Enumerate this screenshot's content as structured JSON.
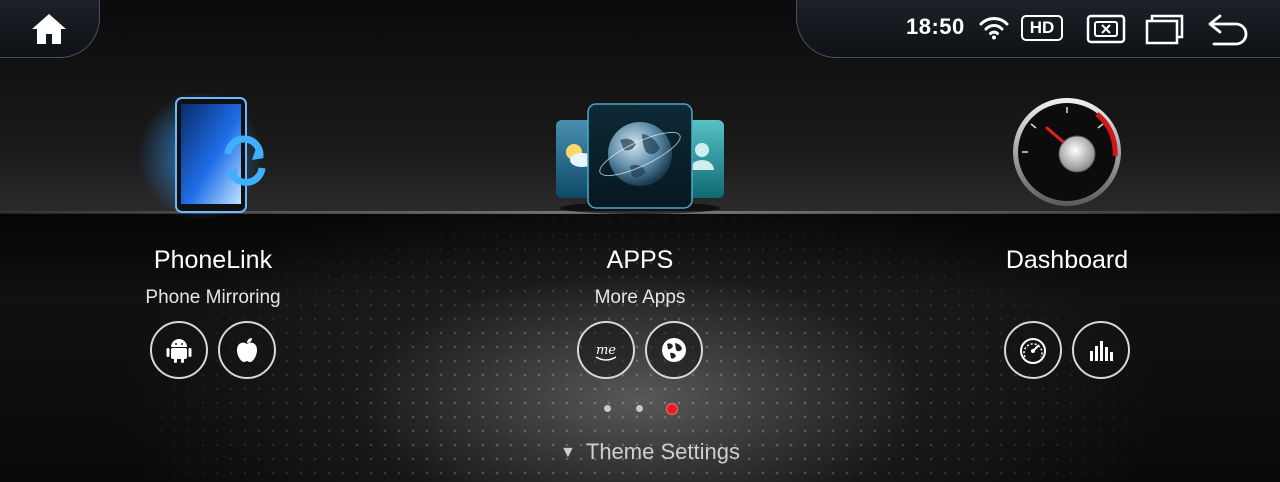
{
  "status_bar": {
    "time": "18:50",
    "hd_label": "HD",
    "icons": [
      "home-icon",
      "wifi-icon",
      "close-app-icon",
      "recents-icon",
      "back-icon"
    ]
  },
  "tiles": [
    {
      "title": "PhoneLink",
      "subtitle": "Phone Mirroring",
      "graphic": "phone-sync-graphic",
      "buttons": [
        "android-icon",
        "apple-icon"
      ]
    },
    {
      "title": "APPS",
      "subtitle": "More Apps",
      "graphic": "app-cards-graphic",
      "buttons": [
        "me-icon",
        "globe-icon"
      ]
    },
    {
      "title": "Dashboard",
      "subtitle": "",
      "graphic": "speedometer-graphic",
      "buttons": [
        "gauge-icon",
        "equalizer-icon"
      ]
    }
  ],
  "pager": {
    "count": 3,
    "active_index": 2,
    "active_color": "#e02020"
  },
  "theme_settings": {
    "label": "Theme Settings",
    "arrow": "▼"
  }
}
